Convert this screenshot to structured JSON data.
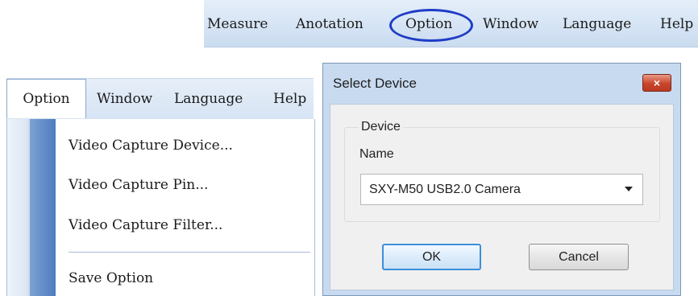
{
  "top_menu": {
    "items": [
      "Measure",
      "Anotation",
      "Option",
      "Window",
      "Language",
      "Help"
    ],
    "highlighted": "Option",
    "highlight_color": "#1f3cc6"
  },
  "option_menu": {
    "bar_items": [
      "Option",
      "Window",
      "Language",
      "Help"
    ],
    "active": "Option",
    "items": [
      "Video Capture Device...",
      "Video Capture Pin...",
      "Video Capture Filter...",
      "Save Option"
    ]
  },
  "dialog": {
    "title": "Select Device",
    "close_label": "×",
    "group_label": "Device",
    "name_label": "Name",
    "select_value": "SXY-M50 USB2.0 Camera",
    "ok_label": "OK",
    "cancel_label": "Cancel",
    "close_color": "#c9452b"
  }
}
